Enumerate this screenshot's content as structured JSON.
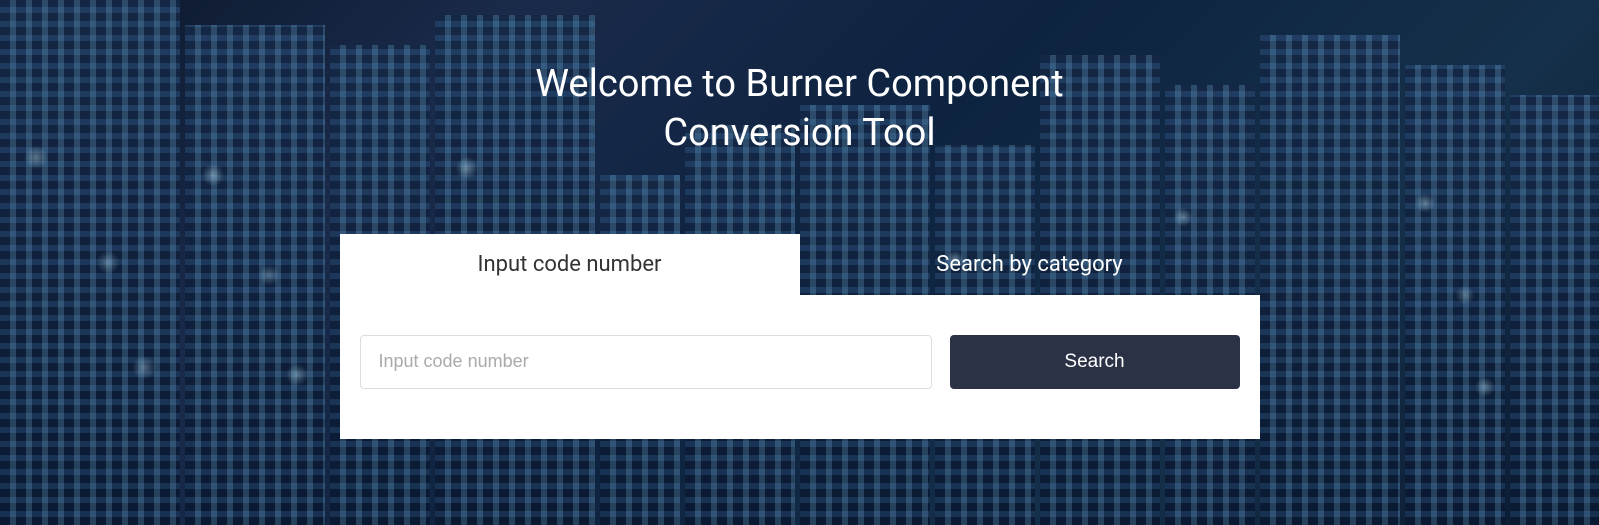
{
  "header": {
    "title": "Welcome to Burner Component Conversion Tool"
  },
  "tabs": {
    "active_label": "Input code number",
    "inactive_label": "Search by category"
  },
  "search": {
    "placeholder": "Input code number",
    "button_label": "Search"
  }
}
